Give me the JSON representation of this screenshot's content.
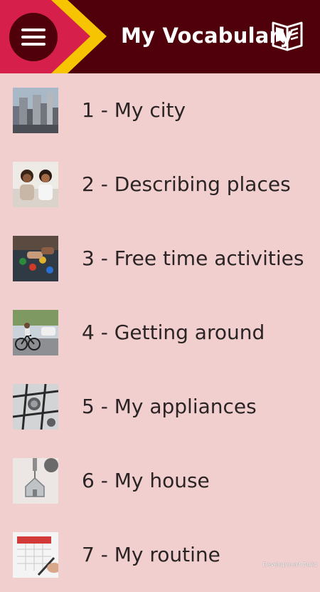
{
  "header": {
    "title": "My Vocabulary",
    "menu_icon": "hamburger-icon",
    "book_icon": "open-book-icon",
    "colors": {
      "background": "#4f000a",
      "chevron_pink": "#d61f4a",
      "chevron_yellow": "#f6c400"
    }
  },
  "lessons": [
    {
      "label": "1 - My city",
      "image": "city-skyline-thumbnail"
    },
    {
      "label": "2 - Describing places",
      "image": "two-people-talking-thumbnail"
    },
    {
      "label": "3 - Free time activities",
      "image": "board-game-thumbnail"
    },
    {
      "label": "4 - Getting around",
      "image": "cyclist-thumbnail"
    },
    {
      "label": "5 - My appliances",
      "image": "gas-stove-thumbnail"
    },
    {
      "label": "6 - My house",
      "image": "house-keychain-thumbnail"
    },
    {
      "label": "7 - My routine",
      "image": "calendar-writing-thumbnail"
    }
  ],
  "footer": {
    "build_label": "Development Build"
  },
  "colors": {
    "page_background": "#f1cfcf",
    "text": "#2b2424"
  }
}
